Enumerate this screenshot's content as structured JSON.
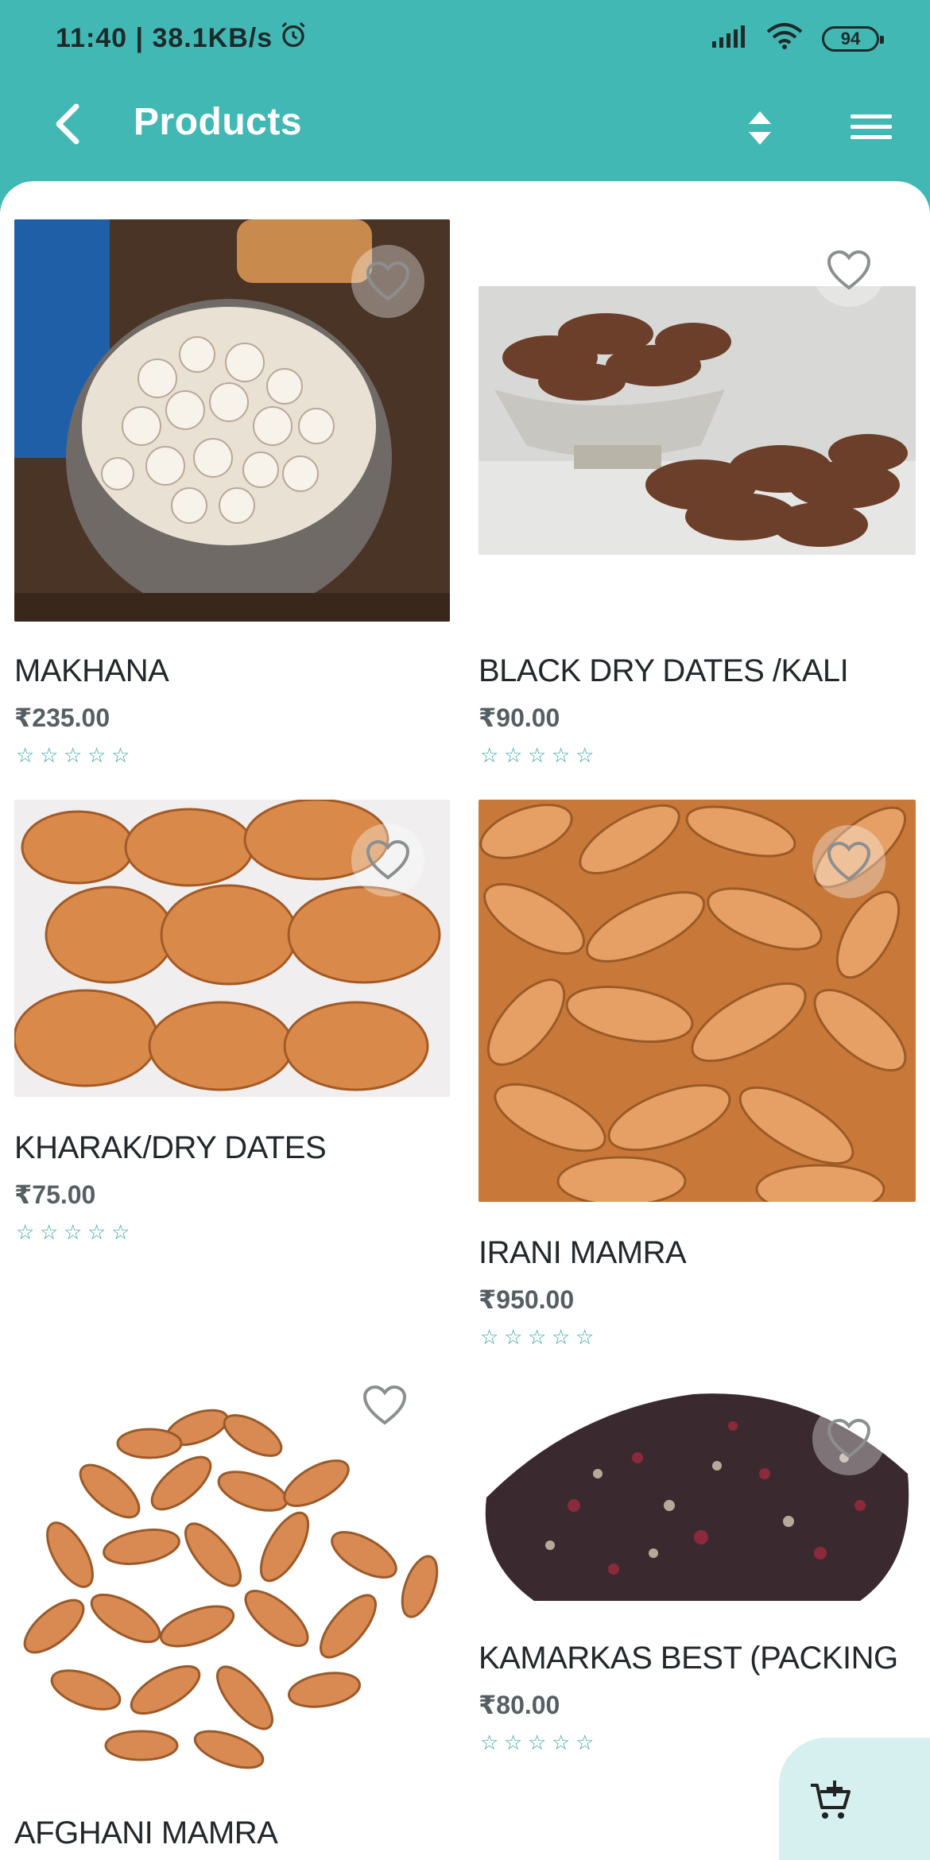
{
  "status": {
    "time_speed": "11:40 | 38.1KB/s",
    "battery": "94"
  },
  "header": {
    "title": "Products"
  },
  "products": [
    {
      "name": "MAKHANA",
      "price": "₹235.00",
      "rating": 0
    },
    {
      "name": "BLACK DRY DATES /KALI",
      "price": "₹90.00",
      "rating": 0
    },
    {
      "name": "KHARAK/DRY DATES",
      "price": "₹75.00",
      "rating": 0
    },
    {
      "name": "IRANI MAMRA",
      "price": "₹950.00",
      "rating": 0
    },
    {
      "name": "AFGHANI MAMRA",
      "price": "",
      "rating": 0
    },
    {
      "name": "KAMARKAS BEST (PACKING",
      "price": "₹80.00",
      "rating": 0
    }
  ],
  "colors": {
    "primary": "#42b8b4",
    "star": "#3aa9a6",
    "cart_fab": "#d6f0ef"
  }
}
